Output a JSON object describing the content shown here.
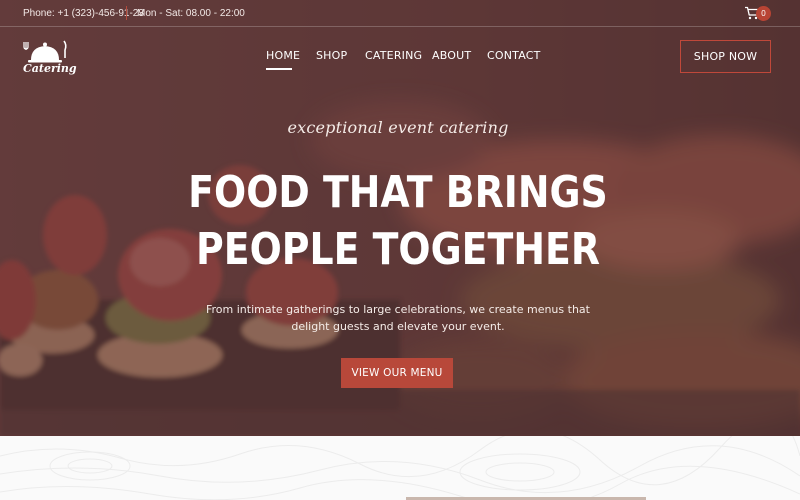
{
  "topbar": {
    "phone": "Phone: +1 (323)-456-91-23",
    "hours": "Mon - Sat: 08.00 - 22:00",
    "cart_icon": "shopping-cart-icon",
    "cart_count": "0"
  },
  "logo": {
    "text": "Catering",
    "icon": "cloche-cutlery-icon"
  },
  "nav": {
    "items": [
      {
        "label": "HOME",
        "active": true
      },
      {
        "label": "SHOP"
      },
      {
        "label": "CATERING"
      },
      {
        "label": "ABOUT"
      },
      {
        "label": "CONTACT"
      }
    ]
  },
  "header": {
    "shop_now_label": "SHOP NOW"
  },
  "hero": {
    "script": "exceptional event catering",
    "headline_1": "FOOD THAT BRINGS",
    "headline_2": "PEOPLE TOGETHER",
    "subtitle_1": "From intimate gatherings to large celebrations, we create menus that",
    "subtitle_2": "delight guests and elevate your event.",
    "cta_label": "VIEW OUR MENU"
  },
  "colors": {
    "accent": "#b8483a",
    "overlay": "#5c3434"
  }
}
